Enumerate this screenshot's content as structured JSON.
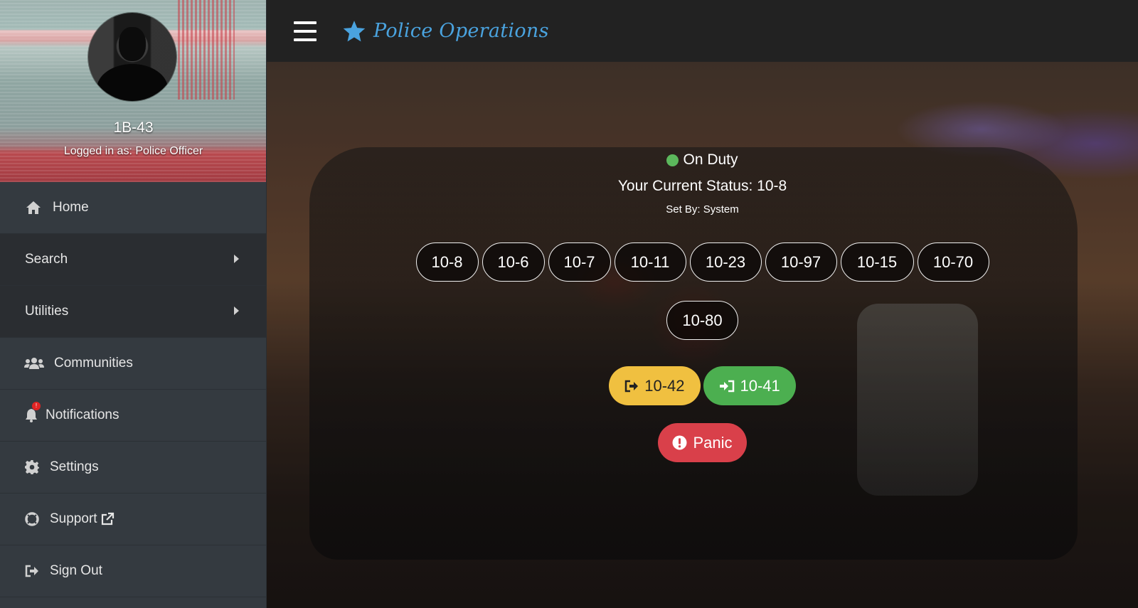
{
  "profile": {
    "callsign": "1B-43",
    "logged_in": "Logged in as: Police Officer"
  },
  "sidebar": {
    "items": [
      {
        "label": "Home",
        "icon": "home-icon"
      },
      {
        "label": "Search",
        "icon": "caret-right-icon"
      },
      {
        "label": "Utilities",
        "icon": "caret-right-icon"
      },
      {
        "label": "Communities",
        "icon": "users-icon"
      },
      {
        "label": "Notifications",
        "icon": "bell-icon",
        "badge": "!"
      },
      {
        "label": "Settings",
        "icon": "gear-icon"
      },
      {
        "label": "Support",
        "icon": "life-ring-icon"
      },
      {
        "label": "Sign Out",
        "icon": "sign-out-icon"
      }
    ]
  },
  "header": {
    "title": "Police Operations",
    "brand_color": "#4aa3df"
  },
  "status": {
    "duty": "On Duty",
    "current": "Your Current Status: 10-8",
    "set_by": "Set By: System"
  },
  "codes": [
    "10-8",
    "10-6",
    "10-7",
    "10-11",
    "10-23",
    "10-97",
    "10-15",
    "10-70",
    "10-80"
  ],
  "actions": {
    "out_of_service": "10-42",
    "in_service": "10-41",
    "panic": "Panic"
  },
  "colors": {
    "on_duty": "#5cb85c",
    "btn_1042": "#f0c040",
    "btn_1041": "#4caf50",
    "btn_panic": "#d9404a"
  }
}
